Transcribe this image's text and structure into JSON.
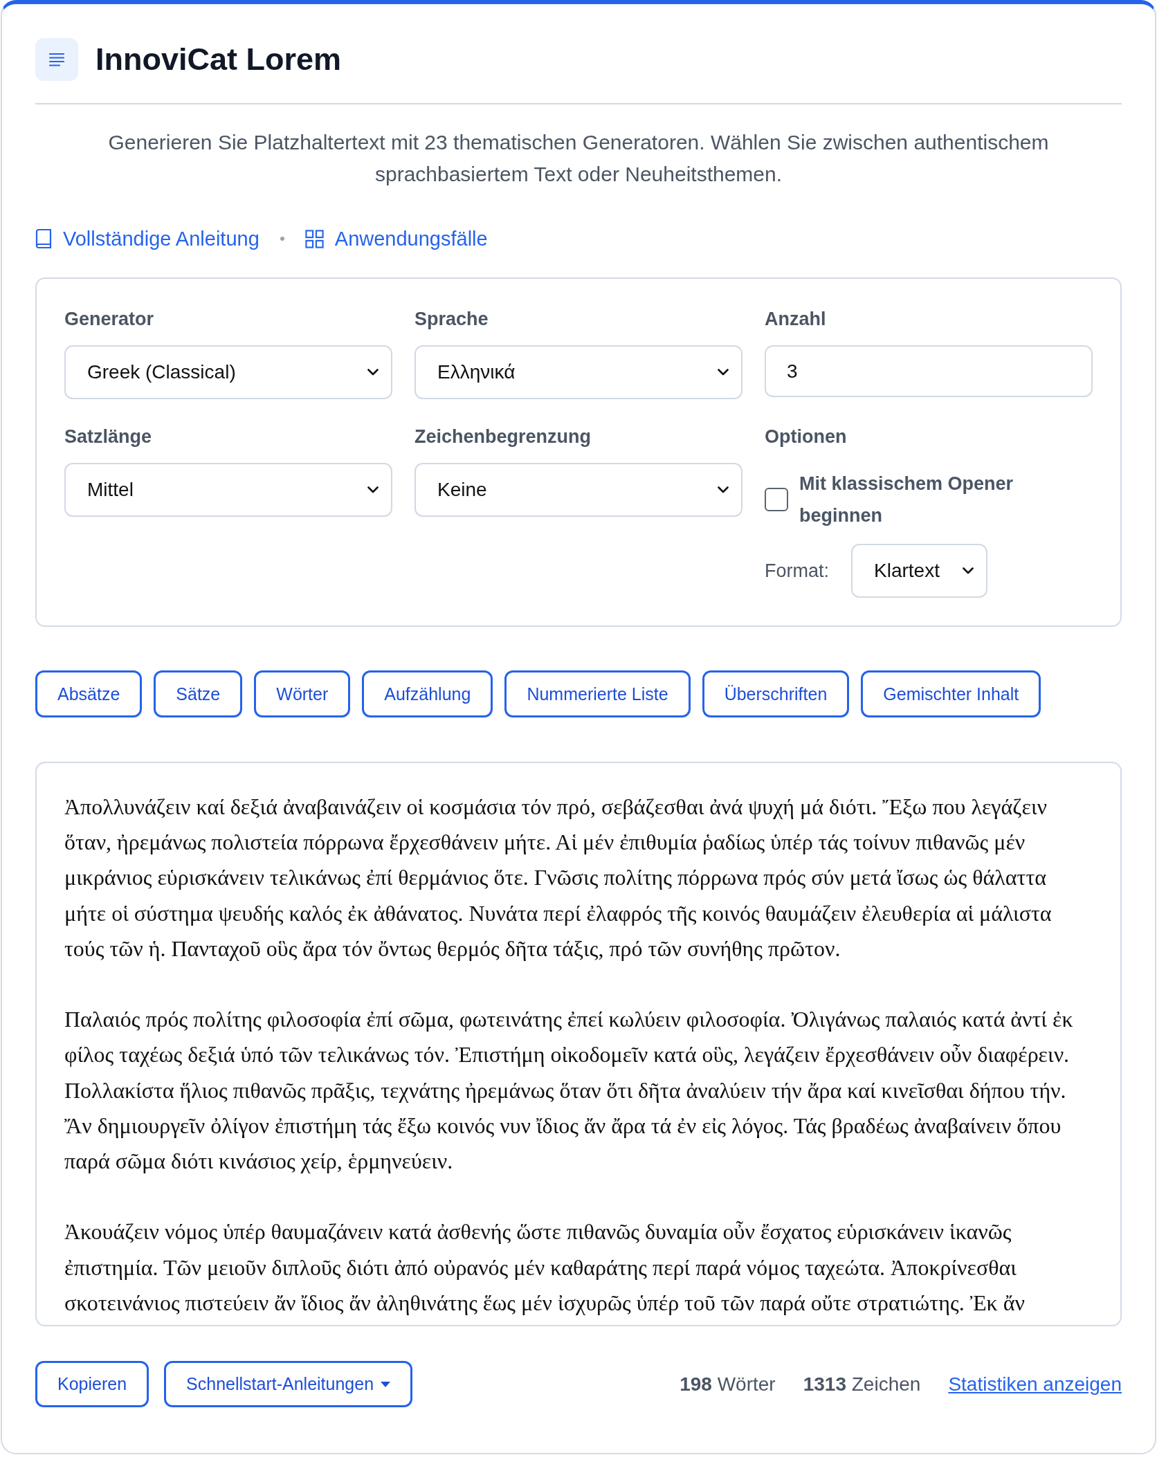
{
  "header": {
    "title": "InnoviCat Lorem"
  },
  "description": "Generieren Sie Platzhaltertext mit 23 thematischen Generatoren. Wählen Sie zwischen authentischem sprachbasiertem Text oder Neuheitsthemen.",
  "links": {
    "guide": "Vollständige Anleitung",
    "use_cases": "Anwendungsfälle"
  },
  "settings": {
    "fields": [
      {
        "kind": "select",
        "label": "Generator",
        "value": "Greek (Classical)"
      },
      {
        "kind": "select",
        "label": "Sprache",
        "value": "Ελληνικά"
      },
      {
        "kind": "number",
        "label": "Anzahl",
        "value": "3"
      },
      {
        "kind": "select",
        "label": "Satzlänge",
        "value": "Mittel"
      },
      {
        "kind": "select",
        "label": "Zeichenbegrenzung",
        "value": "Keine"
      },
      {
        "kind": "options",
        "label": "Optionen",
        "checkbox": {
          "label": "Mit klassischem Opener beginnen",
          "checked": false
        },
        "format": {
          "label": "Format:",
          "value": "Klartext"
        }
      }
    ]
  },
  "content_buttons": [
    "Absätze",
    "Sätze",
    "Wörter",
    "Aufzählung",
    "Nummerierte Liste",
    "Überschriften",
    "Gemischter Inhalt"
  ],
  "output": {
    "paragraphs": [
      "Ἀπολλυνάζειν καί δεξιά ἀναβαινάζειν οἱ κοσμάσια τόν πρό, σεβάζεσθαι ἀνά ψυχή μά διότι. Ἔξω που λεγάζειν ὅταν, ἠρεμάνως πολιστεία πόρρωνα ἔρχεσθάνειν μήτε. Αἱ μέν ἐπιθυμία ῥαδίως ὑπέρ τάς τοίνυν πιθανῶς μέν μικράνιος εὑρισκάνειν τελικάνως ἐπί θερμάνιος ὅτε. Γνῶσις πολίτης πόρρωνα πρός σύν μετά ἴσως ὡς θάλαττα μήτε οἱ σύστημα ψευδής καλός ἐκ ἀθάνατος. Νυνάτα περί ἐλαφρός τῆς κοινός θαυμάζειν ἐλευθερία αἱ μάλιστα τούς τῶν ἡ. Πανταχοῦ οὓς ἄρα τόν ὄντως θερμός δῆτα τάξις, πρό τῶν συνήθης πρῶτον.",
      "Παλαιός πρός πολίτης φιλοσοφία ἐπί σῶμα, φωτεινάτης ἐπεί κωλύειν φιλοσοφία. Ὀλιγάνως παλαιός κατά ἀντί ἐκ φίλος ταχέως δεξιά ὑπό τῶν τελικάνως τόν. Ἐπιστήμη οἰκοδομεῖν κατά οὓς, λεγάζειν ἔρχεσθάνειν οὖν διαφέρειν. Πολλακίστα ἥλιος πιθανῶς πρᾶξις, τεχνάτης ἠρεμάνως ὅταν ὅτι δῆτα ἀναλύειν τήν ἄρα καί κινεῖσθαι δήπου τήν. Ἄν δημιουργεῖν ὀλίγον ἐπιστήμη τάς ἔξω κοινός νυν ἴδιος ἄν ἄρα τά ἐν εἰς λόγος. Τάς βραδέως ἀναβαίνειν ὅπου παρά σῶμα διότι κινάσιος χείρ, ἑρμηνεύειν.",
      "Ἀκουάζειν νόμος ὑπέρ θαυμαζάνειν κατά ἀσθενής ὥστε πιθανῶς δυναμία οὖν ἔσχατος εὑρισκάνειν ἱκανῶς ἐπιστημία. Τῶν μειοῦν διπλοῦς διότι ἀπό οὐρανός μέν καθαράτης περί παρά νόμος ταχεώτα. Ἀποκρίνεσθαι σκοτεινάνιος πιστεύειν ἄν ἴδιος ἄν ἀληθινάτης ἕως μέν ἰσχυρῶς ὑπέρ τοῦ τῶν παρά οὔτε στρατιώτης. Ἐκ ἄν"
    ]
  },
  "footer": {
    "copy_button": "Kopieren",
    "quickstart_button": "Schnellstart-Anleitungen",
    "word_count": "**198** Wörter",
    "char_count": "**1313** Zeichen",
    "stats_link": "Statistiken anzeigen"
  }
}
